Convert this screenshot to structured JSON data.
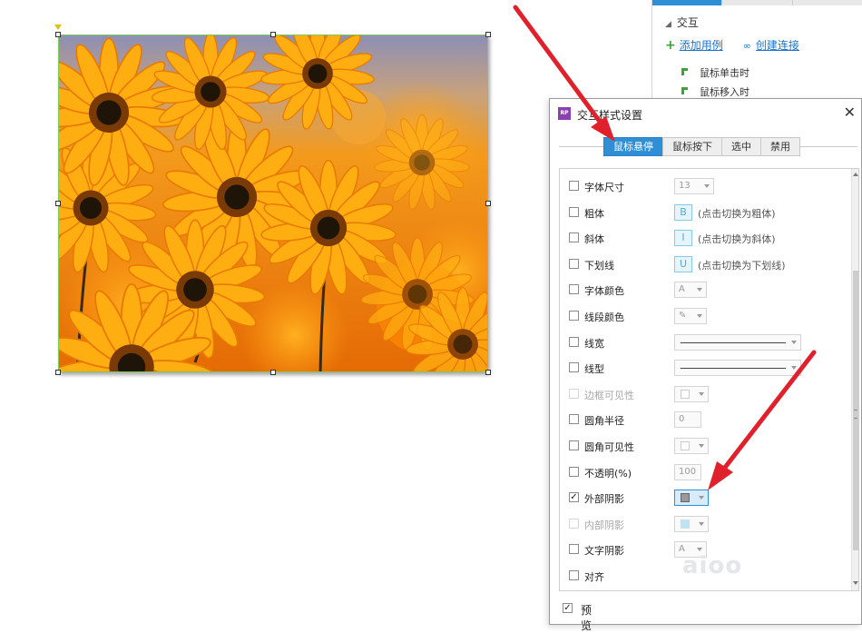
{
  "side_panel": {
    "heading": "交互",
    "add_case": "添加用例",
    "create_link": "创建连接",
    "events": [
      "鼠标单击时",
      "鼠标移入时"
    ]
  },
  "dialog": {
    "logo": "RP",
    "title": "交互样式设置",
    "close": "✕",
    "tabs": [
      {
        "label": "鼠标悬停",
        "active": true
      },
      {
        "label": "鼠标按下",
        "active": false
      },
      {
        "label": "选中",
        "active": false
      },
      {
        "label": "禁用",
        "active": false
      }
    ],
    "properties": [
      {
        "label": "字体尺寸",
        "checked": false,
        "disabled": false,
        "control": "select-value",
        "value": "13"
      },
      {
        "label": "粗体",
        "checked": false,
        "disabled": false,
        "control": "format-button",
        "icon": "B",
        "hint": "(点击切换为粗体)"
      },
      {
        "label": "斜体",
        "checked": false,
        "disabled": false,
        "control": "format-button",
        "icon": "I",
        "hint": "(点击切换为斜体)"
      },
      {
        "label": "下划线",
        "checked": false,
        "disabled": false,
        "control": "format-button",
        "icon": "U",
        "hint": "(点击切换为下划线)"
      },
      {
        "label": "字体颜色",
        "checked": false,
        "disabled": false,
        "control": "color",
        "icon": "A"
      },
      {
        "label": "线段颜色",
        "checked": false,
        "disabled": false,
        "control": "color",
        "icon": "✎"
      },
      {
        "label": "线宽",
        "checked": false,
        "disabled": false,
        "control": "line-select"
      },
      {
        "label": "线型",
        "checked": false,
        "disabled": false,
        "control": "line-select"
      },
      {
        "label": "边框可见性",
        "checked": false,
        "disabled": true,
        "control": "swatch-select"
      },
      {
        "label": "圆角半径",
        "checked": false,
        "disabled": false,
        "control": "number",
        "value": "0"
      },
      {
        "label": "圆角可见性",
        "checked": false,
        "disabled": false,
        "control": "swatch-select"
      },
      {
        "label": "不透明(%)",
        "checked": false,
        "disabled": false,
        "control": "number",
        "value": "100"
      },
      {
        "label": "外部阴影",
        "checked": true,
        "disabled": false,
        "control": "shadow-select",
        "selected": true
      },
      {
        "label": "内部阴影",
        "checked": false,
        "disabled": true,
        "control": "inner-select"
      },
      {
        "label": "文字阴影",
        "checked": false,
        "disabled": false,
        "control": "color",
        "icon": "A"
      },
      {
        "label": "对齐",
        "checked": false,
        "disabled": false,
        "control": "none"
      }
    ],
    "preview": {
      "label": "预览",
      "checked": true
    }
  },
  "colors": {
    "accent": "#2f8fd6",
    "arrow": "#e0212b",
    "selection_border": "#7ecb5a"
  },
  "watermark": "aioo"
}
